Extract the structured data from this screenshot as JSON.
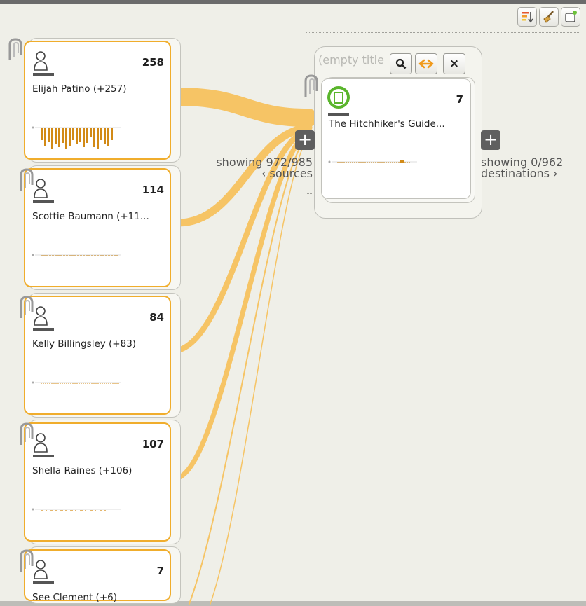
{
  "toolbar": {
    "icons": [
      "sort-icon",
      "broom-icon",
      "new-note-icon"
    ]
  },
  "sources": [
    {
      "name": "Elijah Patino (+257)",
      "count": "258",
      "icon": "person-icon"
    },
    {
      "name": "Scottie Baumann (+11...",
      "count": "114",
      "icon": "person-icon"
    },
    {
      "name": "Kelly Billingsley (+83)",
      "count": "84",
      "icon": "person-icon"
    },
    {
      "name": "Shella Raines (+106)",
      "count": "107",
      "icon": "person-icon"
    },
    {
      "name": "See Clement (+6)",
      "count": "7",
      "icon": "person-icon"
    }
  ],
  "group": {
    "title": "(empty title",
    "buttons": {
      "search": "Q",
      "expand": "↔",
      "close": "×"
    }
  },
  "target": {
    "name": "The Hitchhiker's Guide...",
    "count": "7",
    "icon": "book-icon",
    "icon_color": "#5ab52c"
  },
  "left_panel": {
    "plus": "+",
    "showing": "showing 972/985",
    "sources_link": "‹ sources"
  },
  "right_panel": {
    "plus": "+",
    "showing": "showing 0/962",
    "destinations_link": "destinations ›"
  },
  "colors": {
    "flow": "#f6c465",
    "card_border": "#f0ad2c",
    "histogram": "#d28a16"
  }
}
